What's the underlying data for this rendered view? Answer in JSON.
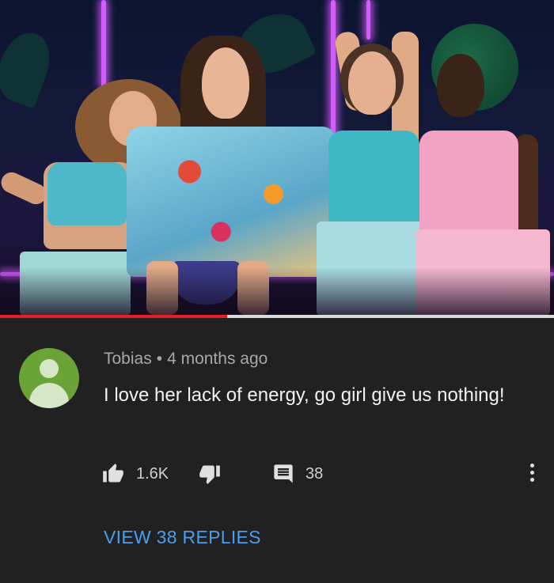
{
  "video": {
    "progress_fraction": 0.41,
    "colors": {
      "progress_fill": "#e52020",
      "progress_track": "#d9d9d9",
      "neon": "#d35cff"
    }
  },
  "comment": {
    "avatar_icon": "person-icon",
    "avatar_color": "#6aa436",
    "author": "Tobias",
    "separator": "•",
    "time": "4 months ago",
    "text": "I love her lack of energy, go girl give us nothing!",
    "likes": "1.6K",
    "replies_count": "38",
    "view_replies_label": "VIEW 38 REPLIES",
    "colors": {
      "text": "#f1f1f1",
      "meta": "#a8a8a8",
      "link": "#4a9df0"
    }
  },
  "icons": {
    "like": "thumbs-up-icon",
    "dislike": "thumbs-down-icon",
    "reply": "comment-icon",
    "more": "more-vert-icon"
  }
}
